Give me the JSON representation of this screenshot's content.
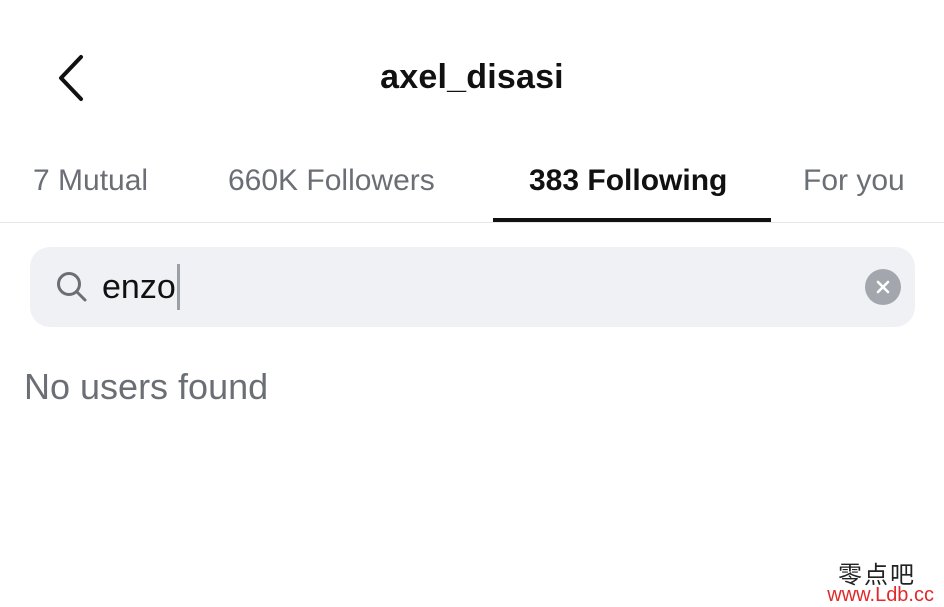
{
  "header": {
    "title": "axel_disasi",
    "back_icon": "chevron-left-icon"
  },
  "tabs": [
    {
      "label": "7 Mutual",
      "active": false
    },
    {
      "label": "660K Followers",
      "active": false
    },
    {
      "label": "383 Following",
      "active": true
    },
    {
      "label": "For you",
      "active": false
    }
  ],
  "search": {
    "value": "enzo",
    "icon": "search-icon",
    "clear_icon": "clear-icon"
  },
  "results": {
    "empty_message": "No users found"
  },
  "watermark": {
    "text": "零点吧",
    "url": "www.Ldb.cc"
  },
  "colors": {
    "active_tab": "#111111",
    "inactive_tab": "#6b6f75",
    "search_bg": "#eff1f4",
    "watermark_url": "#e02a2a"
  }
}
